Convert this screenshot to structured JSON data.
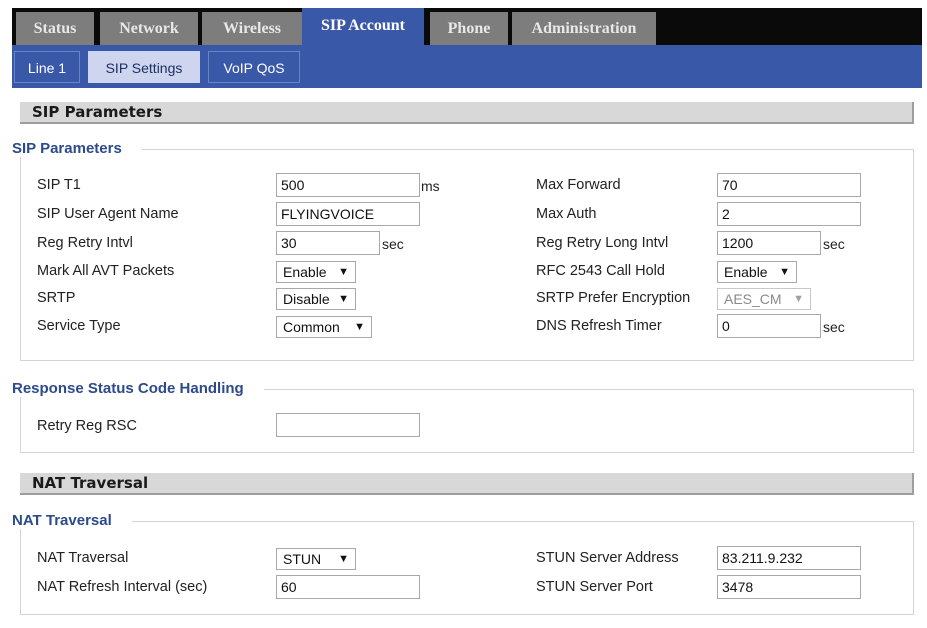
{
  "top_tabs": [
    {
      "label": "Status",
      "active": false
    },
    {
      "label": "Network",
      "active": false
    },
    {
      "label": "Wireless",
      "active": false
    },
    {
      "label": "SIP Account",
      "active": true
    },
    {
      "label": "Phone",
      "active": false
    },
    {
      "label": "Administration",
      "active": false
    }
  ],
  "sub_tabs": [
    {
      "label": "Line 1",
      "active": false
    },
    {
      "label": "SIP Settings",
      "active": true
    },
    {
      "label": "VoIP QoS",
      "active": false
    }
  ],
  "sip_section": {
    "header": "SIP Parameters",
    "legend": "SIP Parameters",
    "sip_t1": {
      "label": "SIP T1",
      "value": "500",
      "unit": "ms"
    },
    "user_agent": {
      "label": "SIP User Agent Name",
      "value": "FLYINGVOICE"
    },
    "reg_retry": {
      "label": "Reg Retry Intvl",
      "value": "30",
      "unit": "sec"
    },
    "mark_avt": {
      "label": "Mark All AVT Packets",
      "value": "Enable"
    },
    "srtp": {
      "label": "SRTP",
      "value": "Disable"
    },
    "service_type": {
      "label": "Service Type",
      "value": "Common"
    },
    "max_forward": {
      "label": "Max Forward",
      "value": "70"
    },
    "max_auth": {
      "label": "Max Auth",
      "value": "2"
    },
    "reg_retry_long": {
      "label": "Reg Retry Long Intvl",
      "value": "1200",
      "unit": "sec"
    },
    "rfc2543": {
      "label": "RFC 2543 Call Hold",
      "value": "Enable"
    },
    "srtp_encryption": {
      "label": "SRTP Prefer Encryption",
      "value": "AES_CM"
    },
    "dns_refresh": {
      "label": "DNS Refresh Timer",
      "value": "0",
      "unit": "sec"
    }
  },
  "response_section": {
    "legend": "Response Status Code Handling",
    "retry_reg_rsc": {
      "label": "Retry Reg RSC",
      "value": ""
    }
  },
  "nat_section": {
    "header": "NAT Traversal",
    "legend": "NAT Traversal",
    "nat_traversal": {
      "label": "NAT Traversal",
      "value": "STUN"
    },
    "nat_refresh": {
      "label": "NAT Refresh Interval (sec)",
      "value": "60"
    },
    "stun_address": {
      "label": "STUN Server Address",
      "value": "83.211.9.232"
    },
    "stun_port": {
      "label": "STUN Server Port",
      "value": "3478"
    }
  },
  "icons": {
    "dropdown": "▼"
  },
  "colors": {
    "accent": "#3a58a8",
    "legend": "#2c4a8c",
    "nav_bg": "#0a0a0a",
    "tab_inactive": "#7d7d7d"
  }
}
